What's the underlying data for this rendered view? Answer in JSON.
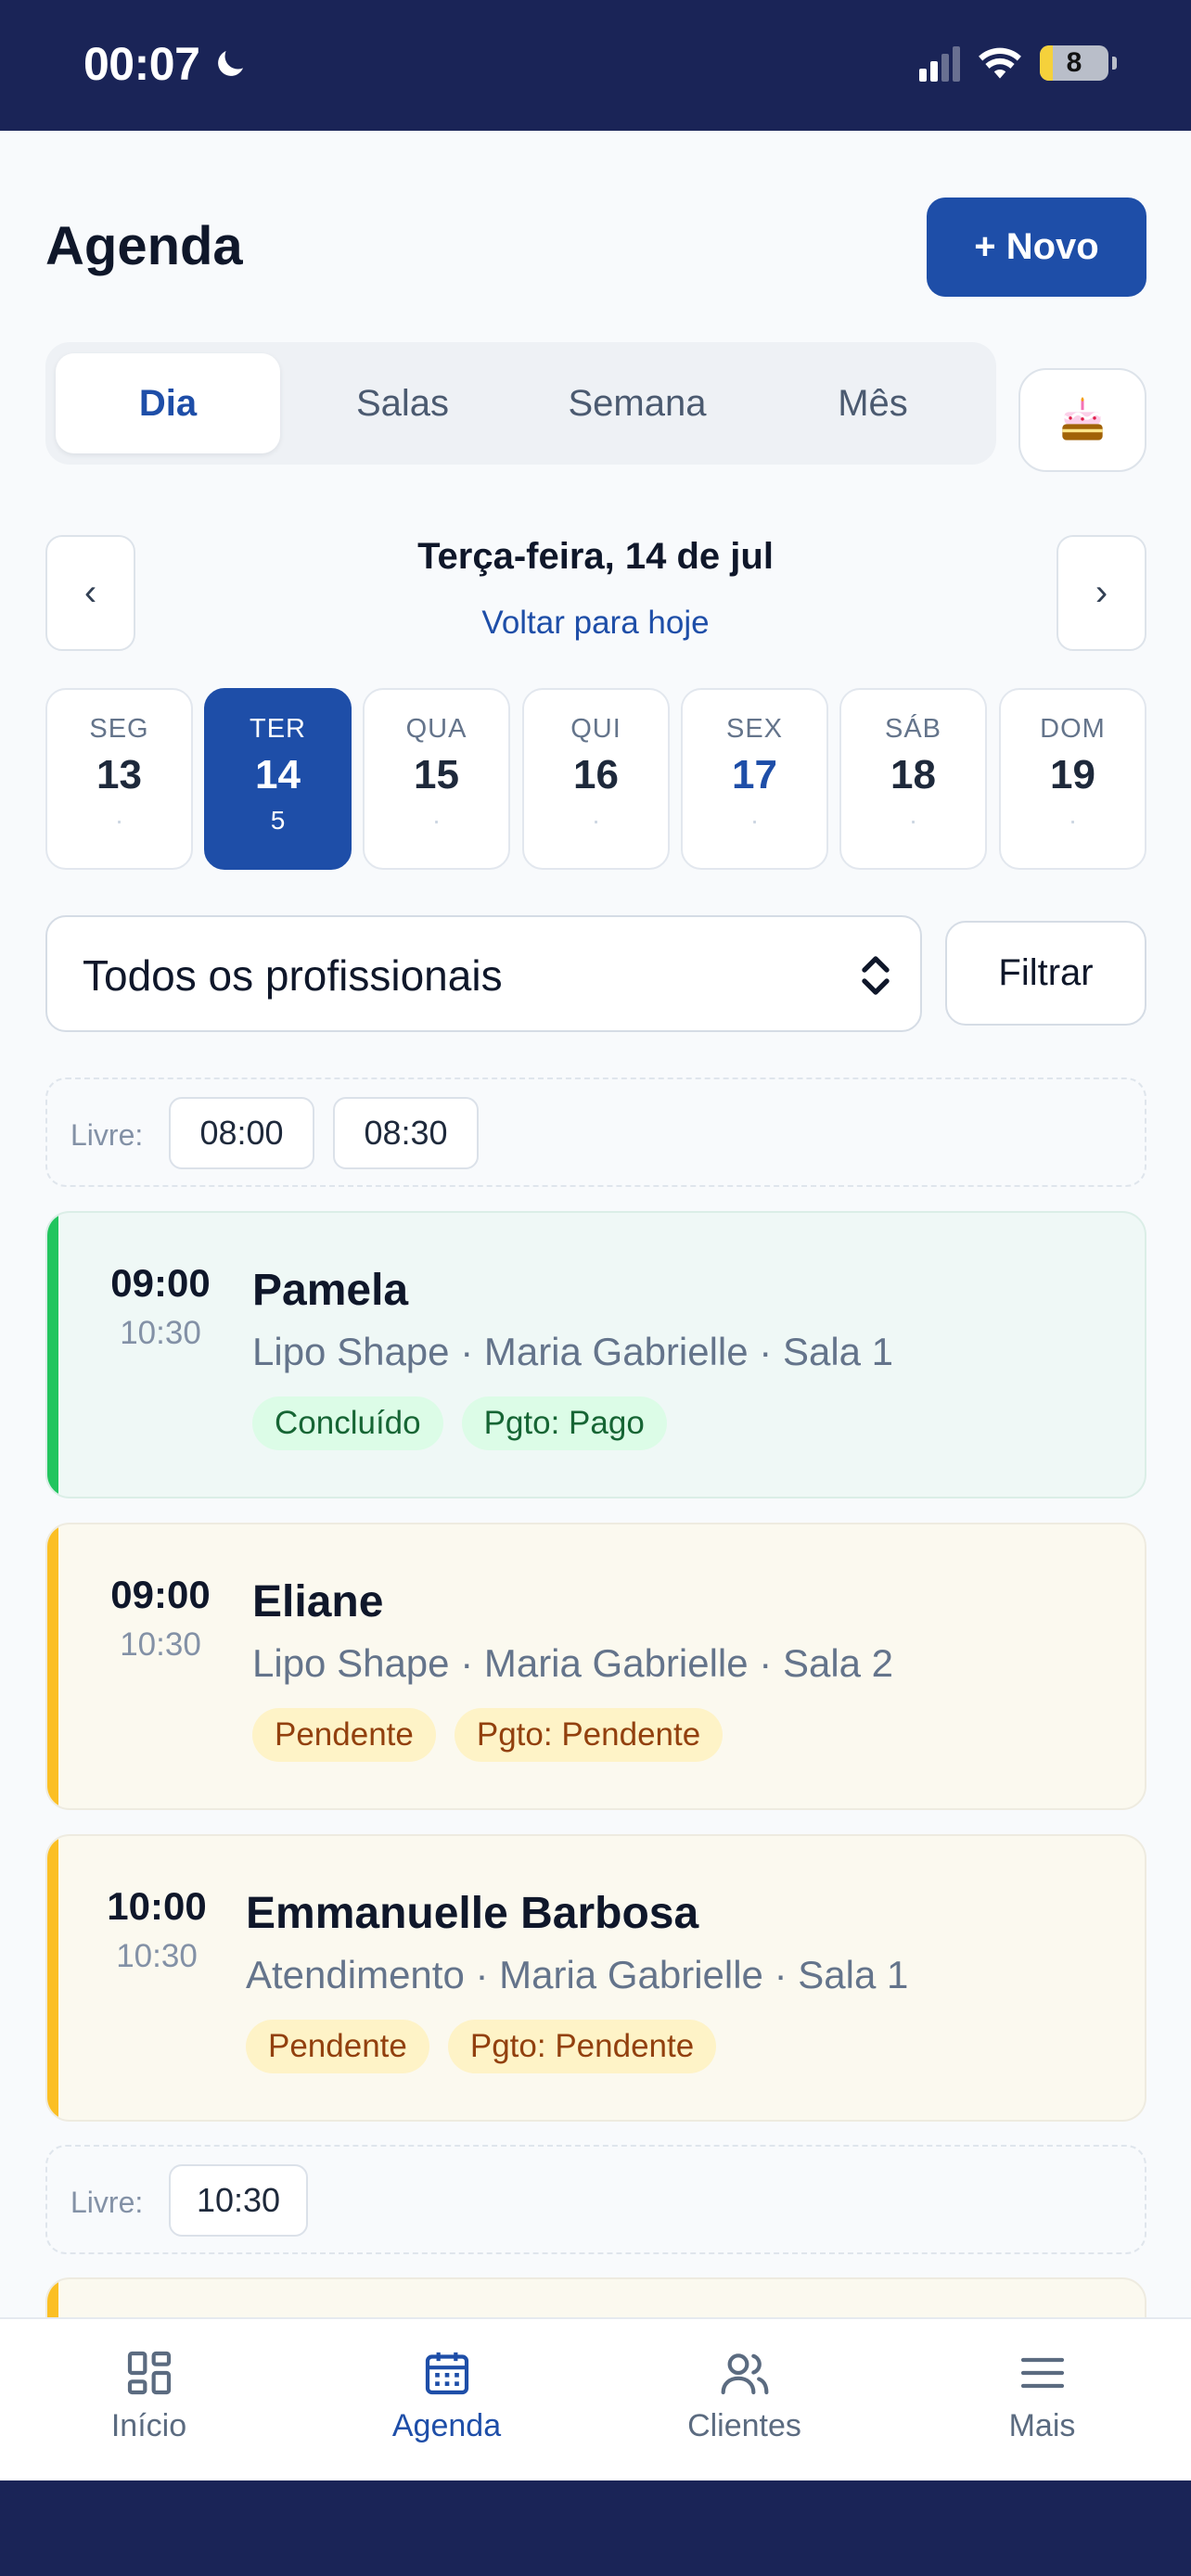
{
  "status_bar": {
    "time": "00:07",
    "battery": "8",
    "focus_icon": "moon-icon"
  },
  "header": {
    "title": "Agenda",
    "new_button": "+ Novo"
  },
  "view_tabs": [
    {
      "label": "Dia",
      "active": true
    },
    {
      "label": "Salas",
      "active": false
    },
    {
      "label": "Semana",
      "active": false
    },
    {
      "label": "Mês",
      "active": false
    }
  ],
  "birthday_icon": "cake-icon",
  "date_nav": {
    "title": "Terça-feira, 14 de jul",
    "today_link": "Voltar para hoje",
    "prev": "‹",
    "next": "›"
  },
  "days": [
    {
      "name": "SEG",
      "num": "13",
      "count": "·"
    },
    {
      "name": "TER",
      "num": "14",
      "count": "5",
      "active": true
    },
    {
      "name": "QUA",
      "num": "15",
      "count": "·"
    },
    {
      "name": "QUI",
      "num": "16",
      "count": "·"
    },
    {
      "name": "SEX",
      "num": "17",
      "count": "·",
      "highlight": true
    },
    {
      "name": "SÁB",
      "num": "18",
      "count": "·"
    },
    {
      "name": "DOM",
      "num": "19",
      "count": "·"
    }
  ],
  "filter": {
    "professional_select": "Todos os profissionais",
    "filter_button": "Filtrar"
  },
  "free_slots_1": {
    "label": "Livre:",
    "slots": [
      "08:00",
      "08:30"
    ]
  },
  "appointments": [
    {
      "start": "09:00",
      "end": "10:30",
      "client": "Pamela",
      "details": "Lipo Shape · Maria Gabrielle · Sala 1",
      "status": "Concluído",
      "payment": "Pgto: Pago"
    },
    {
      "start": "09:00",
      "end": "10:30",
      "client": "Eliane",
      "details": "Lipo Shape · Maria Gabrielle · Sala 2",
      "status": "Pendente",
      "payment": "Pgto: Pendente"
    },
    {
      "start": "10:00",
      "end": "10:30",
      "client": "Emmanuelle Barbosa",
      "details": "Atendimento · Maria Gabrielle · Sala 1",
      "status": "Pendente",
      "payment": "Pgto: Pendente"
    }
  ],
  "free_slots_2": {
    "label": "Livre:",
    "slots": [
      "10:30"
    ]
  },
  "bottom_nav": [
    {
      "label": "Início",
      "icon": "grid-icon"
    },
    {
      "label": "Agenda",
      "icon": "calendar-icon",
      "active": true
    },
    {
      "label": "Clientes",
      "icon": "users-icon"
    },
    {
      "label": "Mais",
      "icon": "menu-icon"
    }
  ],
  "colors": {
    "primary": "#1e4ea8",
    "status_bar": "#1a2457",
    "done": "#22c55e",
    "pending": "#fbbf24"
  }
}
